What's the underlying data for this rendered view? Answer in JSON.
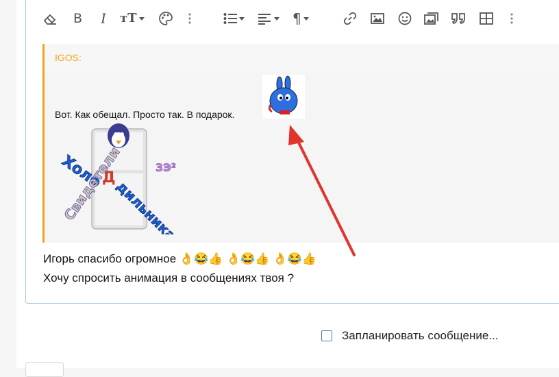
{
  "toolbar": {
    "buttons": [
      {
        "name": "eraser-icon"
      },
      {
        "name": "bold-icon",
        "glyph": "B"
      },
      {
        "name": "italic-icon",
        "glyph": "I"
      },
      {
        "name": "text-size-icon",
        "glyph": "тT"
      },
      {
        "name": "palette-icon"
      },
      {
        "name": "more-vertical-icon"
      },
      {
        "name": "list-icon"
      },
      {
        "name": "align-icon"
      },
      {
        "name": "paragraph-icon",
        "glyph": "¶"
      },
      {
        "name": "link-icon"
      },
      {
        "name": "image-icon"
      },
      {
        "name": "smiley-icon"
      },
      {
        "name": "media-icon"
      },
      {
        "name": "quote-icon"
      },
      {
        "name": "table-icon"
      },
      {
        "name": "more-vertical-icon"
      }
    ]
  },
  "quote": {
    "author": "IGOS:",
    "text": "Вот. Как обещал. Просто так. В подарок.",
    "fridge_image_text": [
      "Холодильника",
      "Свидетели",
      "3Э²"
    ]
  },
  "message": {
    "line1": "Игорь спасибо огромное 👌😂👍 👌😂👍 👌😂👍",
    "line2": "Хочу спросить анимация в сообщениях твоя  ?"
  },
  "schedule": {
    "label": "Запланировать сообщение..."
  },
  "colors": {
    "accent": "#f0a31b",
    "editor_border": "#a7c6de",
    "arrow": "#e0342c",
    "checkbox": "#3d7fc0"
  }
}
